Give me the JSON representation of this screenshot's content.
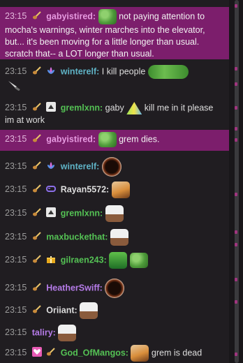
{
  "messages": [
    {
      "time": "23:15",
      "user": "gabyistired:",
      "color": "#c86fd3",
      "highlight": true,
      "text": "not paying attention to mocha's warnings, winter marches into the elevator, but... it's been moving for a little longer than usual. scratch that-- a LOT longer than usual."
    },
    {
      "time": "23:15",
      "user": "winterelf:",
      "color": "#5fb3c6",
      "text": "I kill people"
    },
    {
      "time": "23:15",
      "user": "gremlxnn:",
      "color": "#54c154",
      "text": "gaby",
      "text2": "kill me in it please im at work"
    },
    {
      "time": "23:15",
      "user": "gabyistired:",
      "color": "#c86fd3",
      "highlight": true,
      "text": "grem dies."
    },
    {
      "time": "23:15",
      "user": "winterelf:",
      "color": "#5fb3c6",
      "text": ""
    },
    {
      "time": "23:15",
      "user": "Rayan5572:",
      "color": "#dedede",
      "text": ""
    },
    {
      "time": "23:15",
      "user": "gremlxnn:",
      "color": "#54c154",
      "text": ""
    },
    {
      "time": "23:15",
      "user": "maxbuckethat:",
      "color": "#54c154",
      "text": ""
    },
    {
      "time": "23:15",
      "user": "gilraen243:",
      "color": "#54c154",
      "text": ""
    },
    {
      "time": "23:15",
      "user": "HeatherSwiff:",
      "color": "#b57be8",
      "text": ""
    },
    {
      "time": "23:15",
      "user": "Oriiant:",
      "color": "#dedede",
      "text": ""
    },
    {
      "time": "23:15",
      "user": "taliry:",
      "color": "#b57be8",
      "text": ""
    },
    {
      "time": "23:15",
      "user": "God_OfMangos:",
      "color": "#54c154",
      "text": "grem is dead"
    }
  ],
  "colors": {
    "background": "#201d21",
    "highlight": "#7c1e6c",
    "timestamp": "#9b9b9b"
  },
  "icons": {
    "badge_guitar": "guitar-icon",
    "badge_flower": "lotus-icon",
    "badge_triangle": "triangle-icon",
    "badge_gift": "gift-icon",
    "badge_heart": "heart-icon",
    "badge_controller": "gamepad-icon"
  }
}
